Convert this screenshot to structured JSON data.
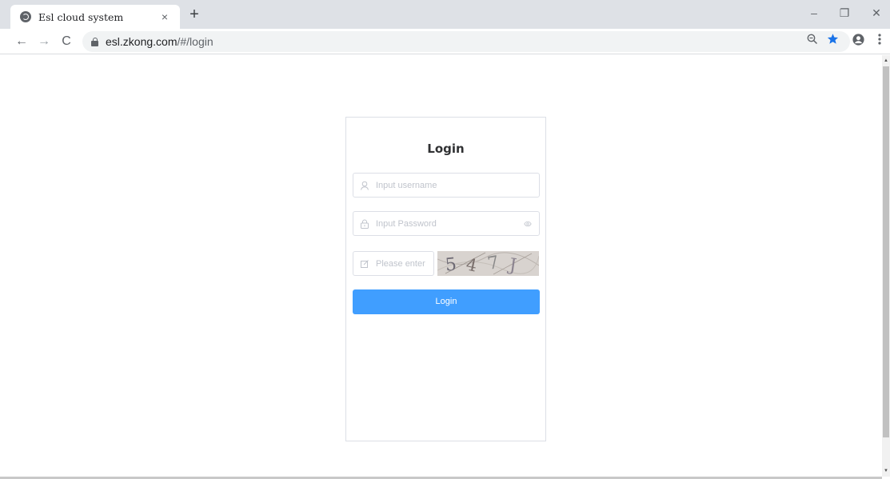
{
  "browser": {
    "tab_title": "Esl cloud system",
    "tab_close": "×",
    "new_tab": "+",
    "url_host": "esl.zkong.com",
    "url_path": "/#/login",
    "window_controls": {
      "minimize": "–",
      "restore": "❐",
      "close": "✕"
    },
    "nav": {
      "back": "←",
      "forward": "→",
      "reload": "C"
    },
    "icons": {
      "zoom": "zoom-out-icon",
      "bookmark": "star-icon",
      "profile": "account-circle-icon",
      "menu": "more-vert-icon"
    },
    "accent_star": "#1a73e8"
  },
  "login": {
    "title": "Login",
    "username": {
      "placeholder": "Input username",
      "value": ""
    },
    "password": {
      "placeholder": "Input Password",
      "value": ""
    },
    "captcha": {
      "placeholder": "Please enter",
      "value": "",
      "image_text": "5 4 7 J"
    },
    "button_label": "Login",
    "button_color": "#409eff"
  }
}
